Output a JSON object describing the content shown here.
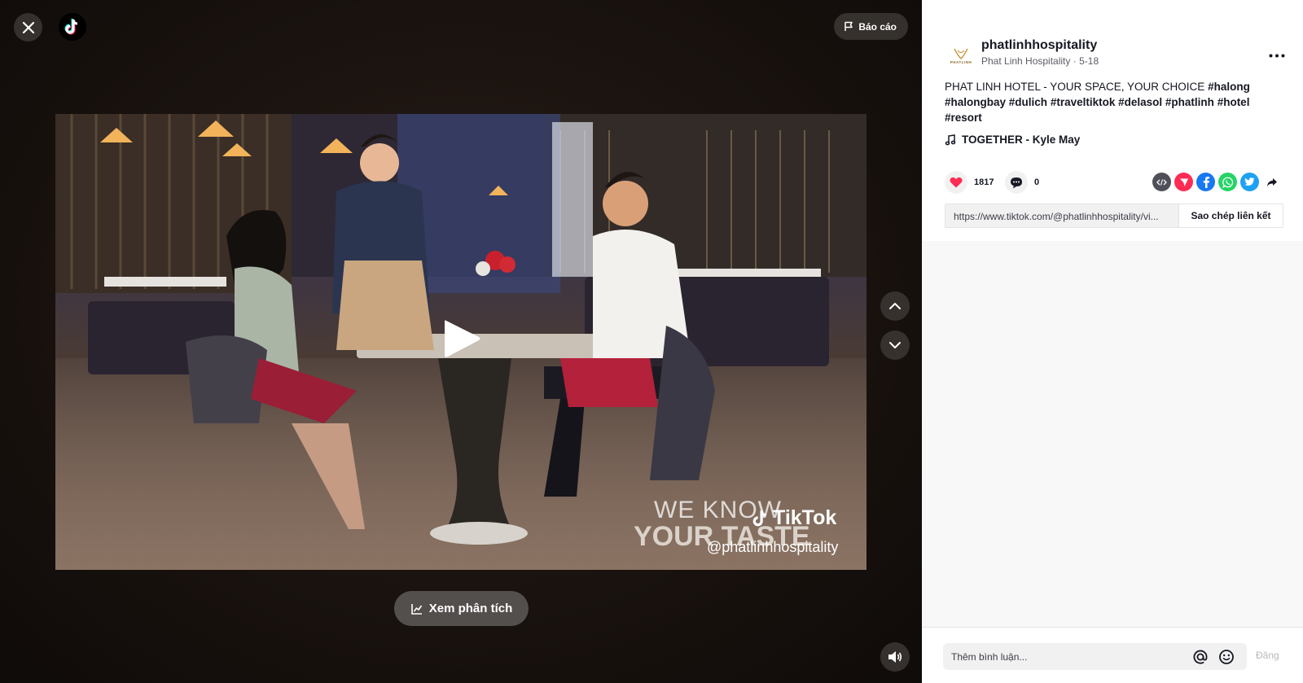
{
  "player": {
    "report_label": "Báo cáo",
    "analytics_label": "Xem phân tích",
    "watermark": {
      "line1": "WE KNOW",
      "line2": "YOUR TASTE",
      "brand": "TikTok",
      "handle": "@phatlinhhospitality"
    }
  },
  "author": {
    "username": "phatlinhhospitality",
    "display_name": "Phat Linh Hospitality",
    "date": "5-18",
    "avatar_text": "PHATLINH"
  },
  "caption": {
    "text": "PHAT LINH HOTEL - YOUR SPACE, YOUR CHOICE ",
    "hashtags": [
      "#halong",
      "#halongbay",
      "#dulich",
      "#traveltiktok",
      "#delasol",
      "#phatlinh",
      "#hotel",
      "#resort"
    ]
  },
  "music": {
    "title": "TOGETHER - Kyle May"
  },
  "stats": {
    "likes": "1817",
    "comments": "0"
  },
  "share": {
    "link": "https://www.tiktok.com/@phatlinhhospitality/vi...",
    "copy_label": "Sao chép liên kết"
  },
  "comment": {
    "placeholder": "Thêm bình luận...",
    "post_label": "Đăng"
  },
  "colors": {
    "like": "#fe2c55",
    "facebook": "#1877f2",
    "whatsapp": "#25d366",
    "twitter": "#1da1f2",
    "embed": "#50505a"
  }
}
